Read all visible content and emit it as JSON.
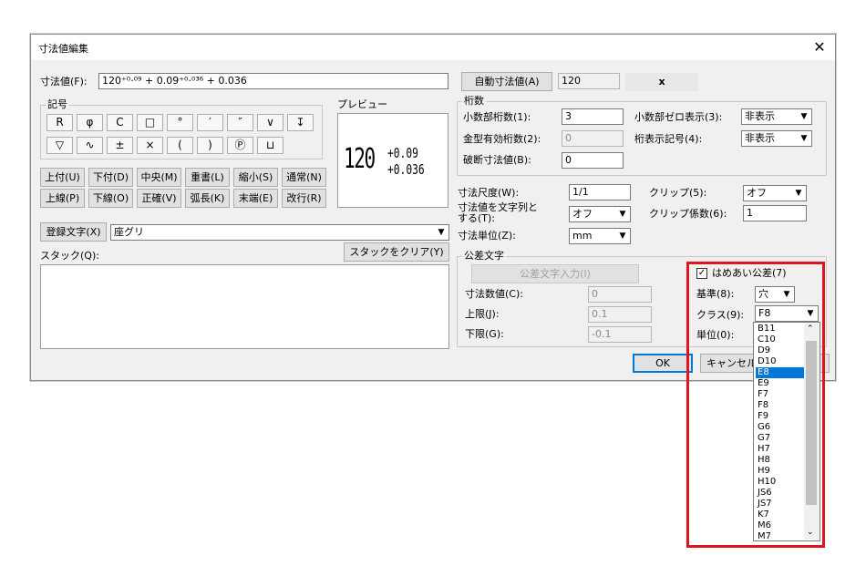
{
  "dialog": {
    "title": "寸法値編集",
    "close": "✕"
  },
  "row1": {
    "label": "寸法値(F):",
    "value": "120⁺⁰·⁰⁹ + 0.09⁺⁰·⁰³⁶ + 0.036",
    "auto_btn": "自動寸法値(A)",
    "auto_value": "120",
    "x_label": "x"
  },
  "symbols": {
    "title": "記号",
    "row1": [
      "R",
      "φ",
      "C",
      "□",
      "°",
      "′",
      "″",
      "∨",
      "↧"
    ],
    "row2": [
      "▽",
      "∿",
      "±",
      "×",
      "(",
      ")",
      "Ⓟ",
      "⊔"
    ]
  },
  "preview": {
    "title": "プレビュー",
    "main": "120",
    "upper": "+0.09",
    "lower": "+0.036"
  },
  "pos_buttons": {
    "row1": [
      "上付(U)",
      "下付(D)",
      "中央(M)",
      "重書(L)",
      "縮小(S)",
      "通常(N)"
    ],
    "row2": [
      "上線(P)",
      "下線(O)",
      "正確(V)",
      "弧長(K)",
      "末端(E)",
      "改行(R)"
    ]
  },
  "register": {
    "button": "登録文字(X)",
    "value": "座グリ"
  },
  "stack": {
    "label": "スタック(Q):",
    "clear_btn": "スタックをクリア(Y)"
  },
  "digits": {
    "title": "桁数",
    "decimal_label": "小数部桁数(1):",
    "decimal_value": "3",
    "mold_label": "金型有効桁数(2):",
    "mold_value": "0",
    "break_label": "破断寸法値(B):",
    "break_value": "0",
    "zero_label": "小数部ゼロ表示(3):",
    "zero_value": "非表示",
    "sep_label": "桁表示記号(4):",
    "sep_value": "非表示"
  },
  "scale": {
    "scale_label": "寸法尺度(W):",
    "scale_value": "1/1",
    "clip_label": "クリップ(5):",
    "clip_value": "オフ",
    "asstr_label": "寸法値を文字列と",
    "asstr_label2": "する(T):",
    "asstr_value": "オフ",
    "clipf_label": "クリップ係数(6):",
    "clipf_value": "1",
    "unit_label": "寸法単位(Z):",
    "unit_value": "mm"
  },
  "tolerance": {
    "title": "公差文字",
    "input_btn": "公差文字入力(I)",
    "num_label": "寸法数値(C):",
    "num_value": "0",
    "upper_label": "上限(J):",
    "upper_value": "0.1",
    "lower_label": "下限(G):",
    "lower_value": "-0.1"
  },
  "fit": {
    "check_label": "はめあい公差(7)",
    "checked": "✓",
    "base_label": "基準(8):",
    "base_value": "穴",
    "class_label": "クラス(9):",
    "class_value": "F8",
    "unit_label": "単位(0):",
    "class_options": [
      "B11",
      "C10",
      "D9",
      "D10",
      "E8",
      "E9",
      "F7",
      "F8",
      "F9",
      "G6",
      "G7",
      "H7",
      "H8",
      "H9",
      "H10",
      "JS6",
      "JS7",
      "K7",
      "M6",
      "M7"
    ],
    "selected": "E8"
  },
  "footer": {
    "ok": "OK",
    "cancel": "キャンセル"
  },
  "colors": {
    "highlight": "#e0141e",
    "selection": "#0078d7"
  }
}
